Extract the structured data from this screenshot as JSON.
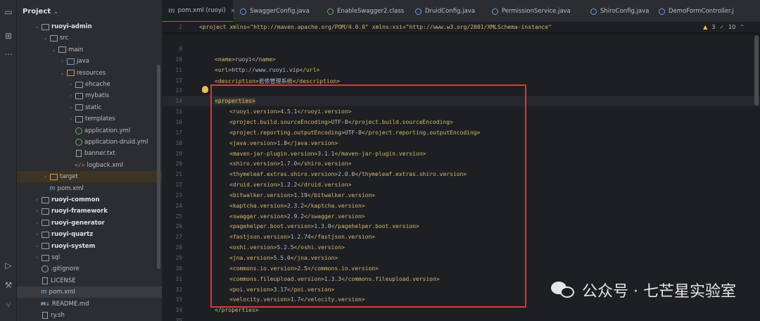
{
  "project_panel": {
    "title": "Project",
    "tree": [
      {
        "label": "ruoyi-admin",
        "indent": 2,
        "arrow": "down",
        "icon": "folder-module",
        "bold": true
      },
      {
        "label": "src",
        "indent": 3,
        "arrow": "down",
        "icon": "folder"
      },
      {
        "label": "main",
        "indent": 4,
        "arrow": "down",
        "icon": "folder"
      },
      {
        "label": "java",
        "indent": 5,
        "arrow": "right",
        "icon": "folder-blue"
      },
      {
        "label": "resources",
        "indent": 5,
        "arrow": "down",
        "icon": "folder-res"
      },
      {
        "label": "ehcache",
        "indent": 6,
        "arrow": "right",
        "icon": "folder"
      },
      {
        "label": "mybatis",
        "indent": 6,
        "arrow": "right",
        "icon": "folder"
      },
      {
        "label": "static",
        "indent": 6,
        "arrow": "right",
        "icon": "folder"
      },
      {
        "label": "templates",
        "indent": 6,
        "arrow": "right",
        "icon": "folder"
      },
      {
        "label": "application.yml",
        "indent": 6,
        "arrow": "",
        "icon": "yml"
      },
      {
        "label": "application-druid.yml",
        "indent": 6,
        "arrow": "",
        "icon": "yml"
      },
      {
        "label": "banner.txt",
        "indent": 6,
        "arrow": "",
        "icon": "file"
      },
      {
        "label": "logback.xml",
        "indent": 6,
        "arrow": "",
        "icon": "xml"
      },
      {
        "label": "target",
        "indent": 3,
        "arrow": "right",
        "icon": "folder-orange",
        "selected": "target"
      },
      {
        "label": "pom.xml",
        "indent": 3,
        "arrow": "",
        "icon": "maven"
      },
      {
        "label": "ruoyi-common",
        "indent": 2,
        "arrow": "right",
        "icon": "folder-module",
        "bold": true
      },
      {
        "label": "ruoyi-framework",
        "indent": 2,
        "arrow": "right",
        "icon": "folder-module",
        "bold": true
      },
      {
        "label": "ruoyi-generator",
        "indent": 2,
        "arrow": "right",
        "icon": "folder-module",
        "bold": true
      },
      {
        "label": "ruoyi-quartz",
        "indent": 2,
        "arrow": "right",
        "icon": "folder-module",
        "bold": true
      },
      {
        "label": "ruoyi-system",
        "indent": 2,
        "arrow": "right",
        "icon": "folder-module",
        "bold": true
      },
      {
        "label": "sql",
        "indent": 2,
        "arrow": "right",
        "icon": "folder"
      },
      {
        "label": ".gitignore",
        "indent": 2,
        "arrow": "",
        "icon": "git"
      },
      {
        "label": "LICENSE",
        "indent": 2,
        "arrow": "",
        "icon": "file"
      },
      {
        "label": "pom.xml",
        "indent": 2,
        "arrow": "",
        "icon": "maven",
        "selected": "pom"
      },
      {
        "label": "README.md",
        "indent": 2,
        "arrow": "",
        "icon": "md"
      },
      {
        "label": "ry.sh",
        "indent": 2,
        "arrow": "",
        "icon": "file"
      }
    ]
  },
  "tabs": [
    {
      "label": "pom.xml (ruoyi)",
      "icon": "maven",
      "active": true
    },
    {
      "label": "SwaggerConfig.java",
      "icon": "class"
    },
    {
      "label": "EnableSwagger2.class",
      "icon": "class-green"
    },
    {
      "label": "DruidConfig.java",
      "icon": "class"
    },
    {
      "label": "PermissionService.java",
      "icon": "class"
    },
    {
      "label": "ShiroConfig.java",
      "icon": "class"
    },
    {
      "label": "DemoFormController.j",
      "icon": "class"
    }
  ],
  "inspections": {
    "warnings": "3",
    "ok": "10"
  },
  "editor": {
    "sticky_line": {
      "num": "2",
      "text": "<project xmlns=\"http://maven.apache.org/POM/4.0.0\" xmlns:xsi=\"http://www.w3.org/2001/XMLSchema-instance\""
    },
    "lines": [
      {
        "num": "9",
        "indent": 1,
        "text": ""
      },
      {
        "num": "10",
        "indent": 1,
        "tag": "name",
        "value": "ruoyi"
      },
      {
        "num": "11",
        "indent": 1,
        "tag": "url",
        "value": "http://www.ruoyi.vip"
      },
      {
        "num": "12",
        "indent": 1,
        "tag": "description",
        "value": "若依管理系统"
      },
      {
        "num": "13",
        "indent": 1,
        "text": ""
      },
      {
        "num": "14",
        "indent": 1,
        "raw": "<properties>",
        "current": true
      },
      {
        "num": "15",
        "indent": 2,
        "tag": "ruoyi.version",
        "value": "4.5.1"
      },
      {
        "num": "16",
        "indent": 2,
        "tag": "project.build.sourceEncoding",
        "value": "UTF-8"
      },
      {
        "num": "17",
        "indent": 2,
        "tag": "project.reporting.outputEncoding",
        "value": "UTF-8"
      },
      {
        "num": "18",
        "indent": 2,
        "tag": "java.version",
        "value": "1.8"
      },
      {
        "num": "19",
        "indent": 2,
        "tag": "maven-jar-plugin.version",
        "value": "3.1.1"
      },
      {
        "num": "20",
        "indent": 2,
        "tag": "shiro.version",
        "value": "1.7.0"
      },
      {
        "num": "21",
        "indent": 2,
        "tag": "thymeleaf.extras.shiro.version",
        "value": "2.0.0"
      },
      {
        "num": "22",
        "indent": 2,
        "tag": "druid.version",
        "value": "1.2.2"
      },
      {
        "num": "23",
        "indent": 2,
        "tag": "bitwalker.version",
        "value": "1.19"
      },
      {
        "num": "24",
        "indent": 2,
        "tag": "kaptcha.version",
        "value": "2.3.2"
      },
      {
        "num": "25",
        "indent": 2,
        "tag": "swagger.version",
        "value": "2.9.2"
      },
      {
        "num": "26",
        "indent": 2,
        "tag": "pagehelper.boot.version",
        "value": "1.3.0"
      },
      {
        "num": "27",
        "indent": 2,
        "tag": "fastjson.version",
        "value": "1.2.74"
      },
      {
        "num": "28",
        "indent": 2,
        "tag": "oshi.version",
        "value": "5.2.5"
      },
      {
        "num": "29",
        "indent": 2,
        "tag": "jna.version",
        "value": "5.5.0"
      },
      {
        "num": "30",
        "indent": 2,
        "tag": "commons.io.version",
        "value": "2.5"
      },
      {
        "num": "31",
        "indent": 2,
        "tag": "commons.fileupload.version",
        "value": "1.3.3"
      },
      {
        "num": "32",
        "indent": 2,
        "tag": "poi.version",
        "value": "3.17"
      },
      {
        "num": "33",
        "indent": 2,
        "tag": "velocity.version",
        "value": "1.7"
      },
      {
        "num": "34",
        "indent": 1,
        "raw": "</properties>"
      },
      {
        "num": "35",
        "indent": 1,
        "text": ""
      }
    ]
  },
  "watermark": {
    "text": "公众号 · 七芒星实验室"
  },
  "colors": {
    "tag": "#d5b778",
    "text": "#bcbec4",
    "string": "#6aab73",
    "highlight_border": "#d83a3a",
    "accent": "#3574f0"
  }
}
